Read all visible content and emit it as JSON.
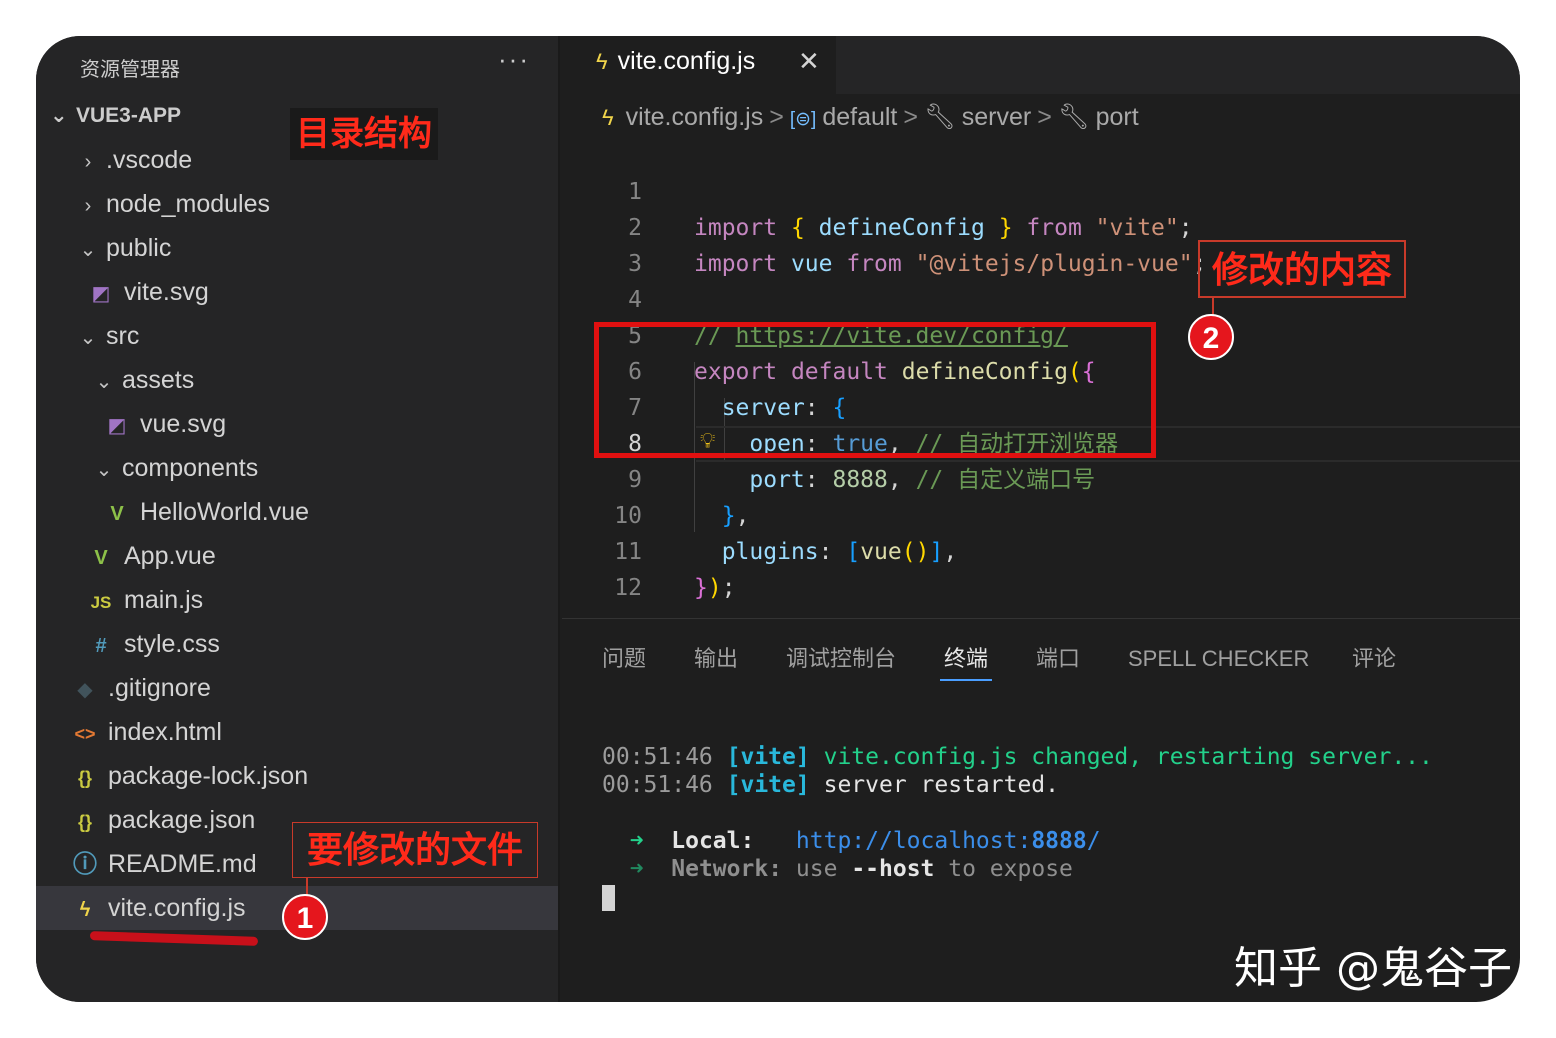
{
  "explorer": {
    "title": "资源管理器",
    "more": "···",
    "project": "VUE3-APP",
    "items": [
      {
        "label": ".vscode",
        "icon": "",
        "chevron": "›"
      },
      {
        "label": "node_modules",
        "icon": "",
        "chevron": "›"
      },
      {
        "label": "public",
        "icon": "",
        "chevron": "⌄"
      },
      {
        "label": "vite.svg",
        "icon": "◩",
        "chevron": ""
      },
      {
        "label": "src",
        "icon": "",
        "chevron": "⌄"
      },
      {
        "label": "assets",
        "icon": "",
        "chevron": "⌄"
      },
      {
        "label": "vue.svg",
        "icon": "◩",
        "chevron": ""
      },
      {
        "label": "components",
        "icon": "",
        "chevron": "⌄"
      },
      {
        "label": "HelloWorld.vue",
        "icon": "V",
        "chevron": ""
      },
      {
        "label": "App.vue",
        "icon": "V",
        "chevron": ""
      },
      {
        "label": "main.js",
        "icon": "JS",
        "chevron": ""
      },
      {
        "label": "style.css",
        "icon": "#",
        "chevron": ""
      },
      {
        "label": ".gitignore",
        "icon": "◆",
        "chevron": ""
      },
      {
        "label": "index.html",
        "icon": "<>",
        "chevron": ""
      },
      {
        "label": "package-lock.json",
        "icon": "{}",
        "chevron": ""
      },
      {
        "label": "package.json",
        "icon": "{}",
        "chevron": ""
      },
      {
        "label": "README.md",
        "icon": "ⓘ",
        "chevron": ""
      },
      {
        "label": "vite.config.js",
        "icon": "ϟ",
        "chevron": ""
      }
    ],
    "selected": "vite.config.js"
  },
  "editor": {
    "tab_label": "vite.config.js",
    "tab_close": "✕",
    "breadcrumb": [
      "vite.config.js",
      "default",
      "server",
      "port"
    ],
    "breadcrumb_sep": ">",
    "line_numbers": [
      "1",
      "2",
      "3",
      "4",
      "5",
      "6",
      "7",
      "8",
      "9",
      "10",
      "11",
      "12"
    ],
    "active_line": "8",
    "code": {
      "l1_import": "import",
      "l1_brace_open": "{",
      "l1_name": "defineConfig",
      "l1_brace_close": "}",
      "l1_from": "from",
      "l1_str": "\"vite\"",
      "l1_semi": ";",
      "l2_import": "import",
      "l2_name": "vue",
      "l2_from": "from",
      "l2_str": "\"@vitejs/plugin-vue\"",
      "l2_semi": ";",
      "l4_comment": "// ",
      "l4_url": "https://vite.dev/config/",
      "l5_export": "export",
      "l5_default": "default",
      "l5_fn": "defineConfig",
      "l5_paren": "(",
      "l5_brace": "{",
      "l6_key": "server",
      "l6_colon": ": ",
      "l6_brace": "{",
      "l7_key": "open",
      "l7_colon": ": ",
      "l7_val": "true",
      "l7_comma": ", ",
      "l7_comment": "// 自动打开浏览器",
      "l8_key": "port",
      "l8_colon": ": ",
      "l8_val": "8888",
      "l8_comma": ", ",
      "l8_comment": "// 自定义端口号",
      "l9_brace": "}",
      "l9_comma": ",",
      "l10_key": "plugins",
      "l10_colon": ": ",
      "l10_bracket_open": "[",
      "l10_fn": "vue",
      "l10_parens": "()",
      "l10_bracket_close": "]",
      "l10_comma": ",",
      "l11_brace": "}",
      "l11_paren": ")",
      "l11_semi": ";"
    }
  },
  "panel": {
    "tabs": [
      "问题",
      "输出",
      "调试控制台",
      "终端",
      "端口",
      "SPELL CHECKER",
      "评论"
    ],
    "active_tab": "终端",
    "terminal": {
      "l1_time": "00:51:46",
      "l1_tag": "[vite]",
      "l1_msg": "vite.config.js changed, restarting server...",
      "l2_time": "00:51:46",
      "l2_tag": "[vite]",
      "l2_msg": "server restarted.",
      "arrow": "➜",
      "local_label": "Local:",
      "local_url_prefix": "http://localhost:",
      "local_port": "8888",
      "local_url_suffix": "/",
      "network_label": "Network:",
      "network_use": "use",
      "network_flag": "--host",
      "network_rest": "to expose"
    }
  },
  "annotations": {
    "dir_structure": "目录结构",
    "file_to_modify": "要修改的文件",
    "modified_content": "修改的内容",
    "num1": "1",
    "num2": "2"
  },
  "watermark": "知乎 @鬼谷子",
  "colors": {
    "editor_bg": "#1e1e1e",
    "sidebar_bg": "#252526",
    "annotation_red": "#e5161d",
    "accent_blue": "#4a9eff"
  }
}
